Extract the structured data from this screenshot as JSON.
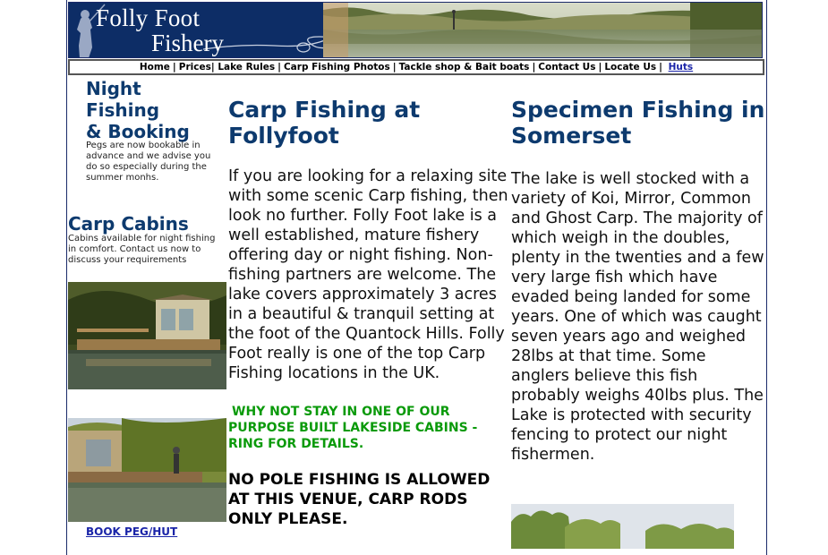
{
  "header": {
    "logo_line1": "Folly Foot",
    "logo_line2": "Fishery"
  },
  "nav": {
    "items": [
      "Home",
      "Prices",
      "Lake Rules",
      "Carp Fishing Photos",
      "Tackle shop & Bait boats",
      "Contact Us",
      "Locate Us",
      "Huts"
    ]
  },
  "sidebar": {
    "night_title_1": "Night",
    "night_title_2": "Fishing",
    "night_title_3": "& Booking",
    "night_text": "Pegs are now bookable in advance and we advise you do so especially during the summer monhs.",
    "cabins_title": "Carp Cabins",
    "cabins_text": "Cabins available for night fishing in comfort. Contact us now to discuss your requirements",
    "book_link": "BOOK PEG/HUT"
  },
  "main": {
    "title": "Carp Fishing at Follyfoot",
    "body": "If you are looking for a relaxing site with some scenic Carp fishing, then look no further. Folly Foot lake is a well established, mature fishery offering day or night fishing. Non-fishing partners are welcome. The lake covers approximately 3 acres in a beautiful & tranquil setting at the foot of the Quantock Hills. Folly Foot really is one of the top Carp Fishing locations in the UK.",
    "cabins_notice_1": "WHY NOT STAY IN ONE OF OUR",
    "cabins_notice_2": "PURPOSE BUILT LAKESIDE CABINS -",
    "cabins_notice_3": "RING FOR DETAILS.",
    "pole_notice": "NO POLE FISHING IS ALLOWED AT THIS VENUE, CARP RODS ONLY PLEASE."
  },
  "specimen": {
    "title": "Specimen Fishing in Somerset",
    "body": "The lake is well stocked with a variety of Koi, Mirror, Common and Ghost Carp. The majority of which weigh in the doubles, plenty in the twenties and a few very large fish which have evaded being landed for some years. One of which was caught seven years ago and weighed 28lbs at that time. Some anglers believe this fish probably weighs 40lbs plus. The Lake is protected with security fencing  to protect our night fishermen."
  },
  "colors": {
    "heading": "#0d3a6e",
    "logo_bg": "#0d2d66",
    "notice_green": "#0a9a0a",
    "link": "#1a24a8"
  }
}
